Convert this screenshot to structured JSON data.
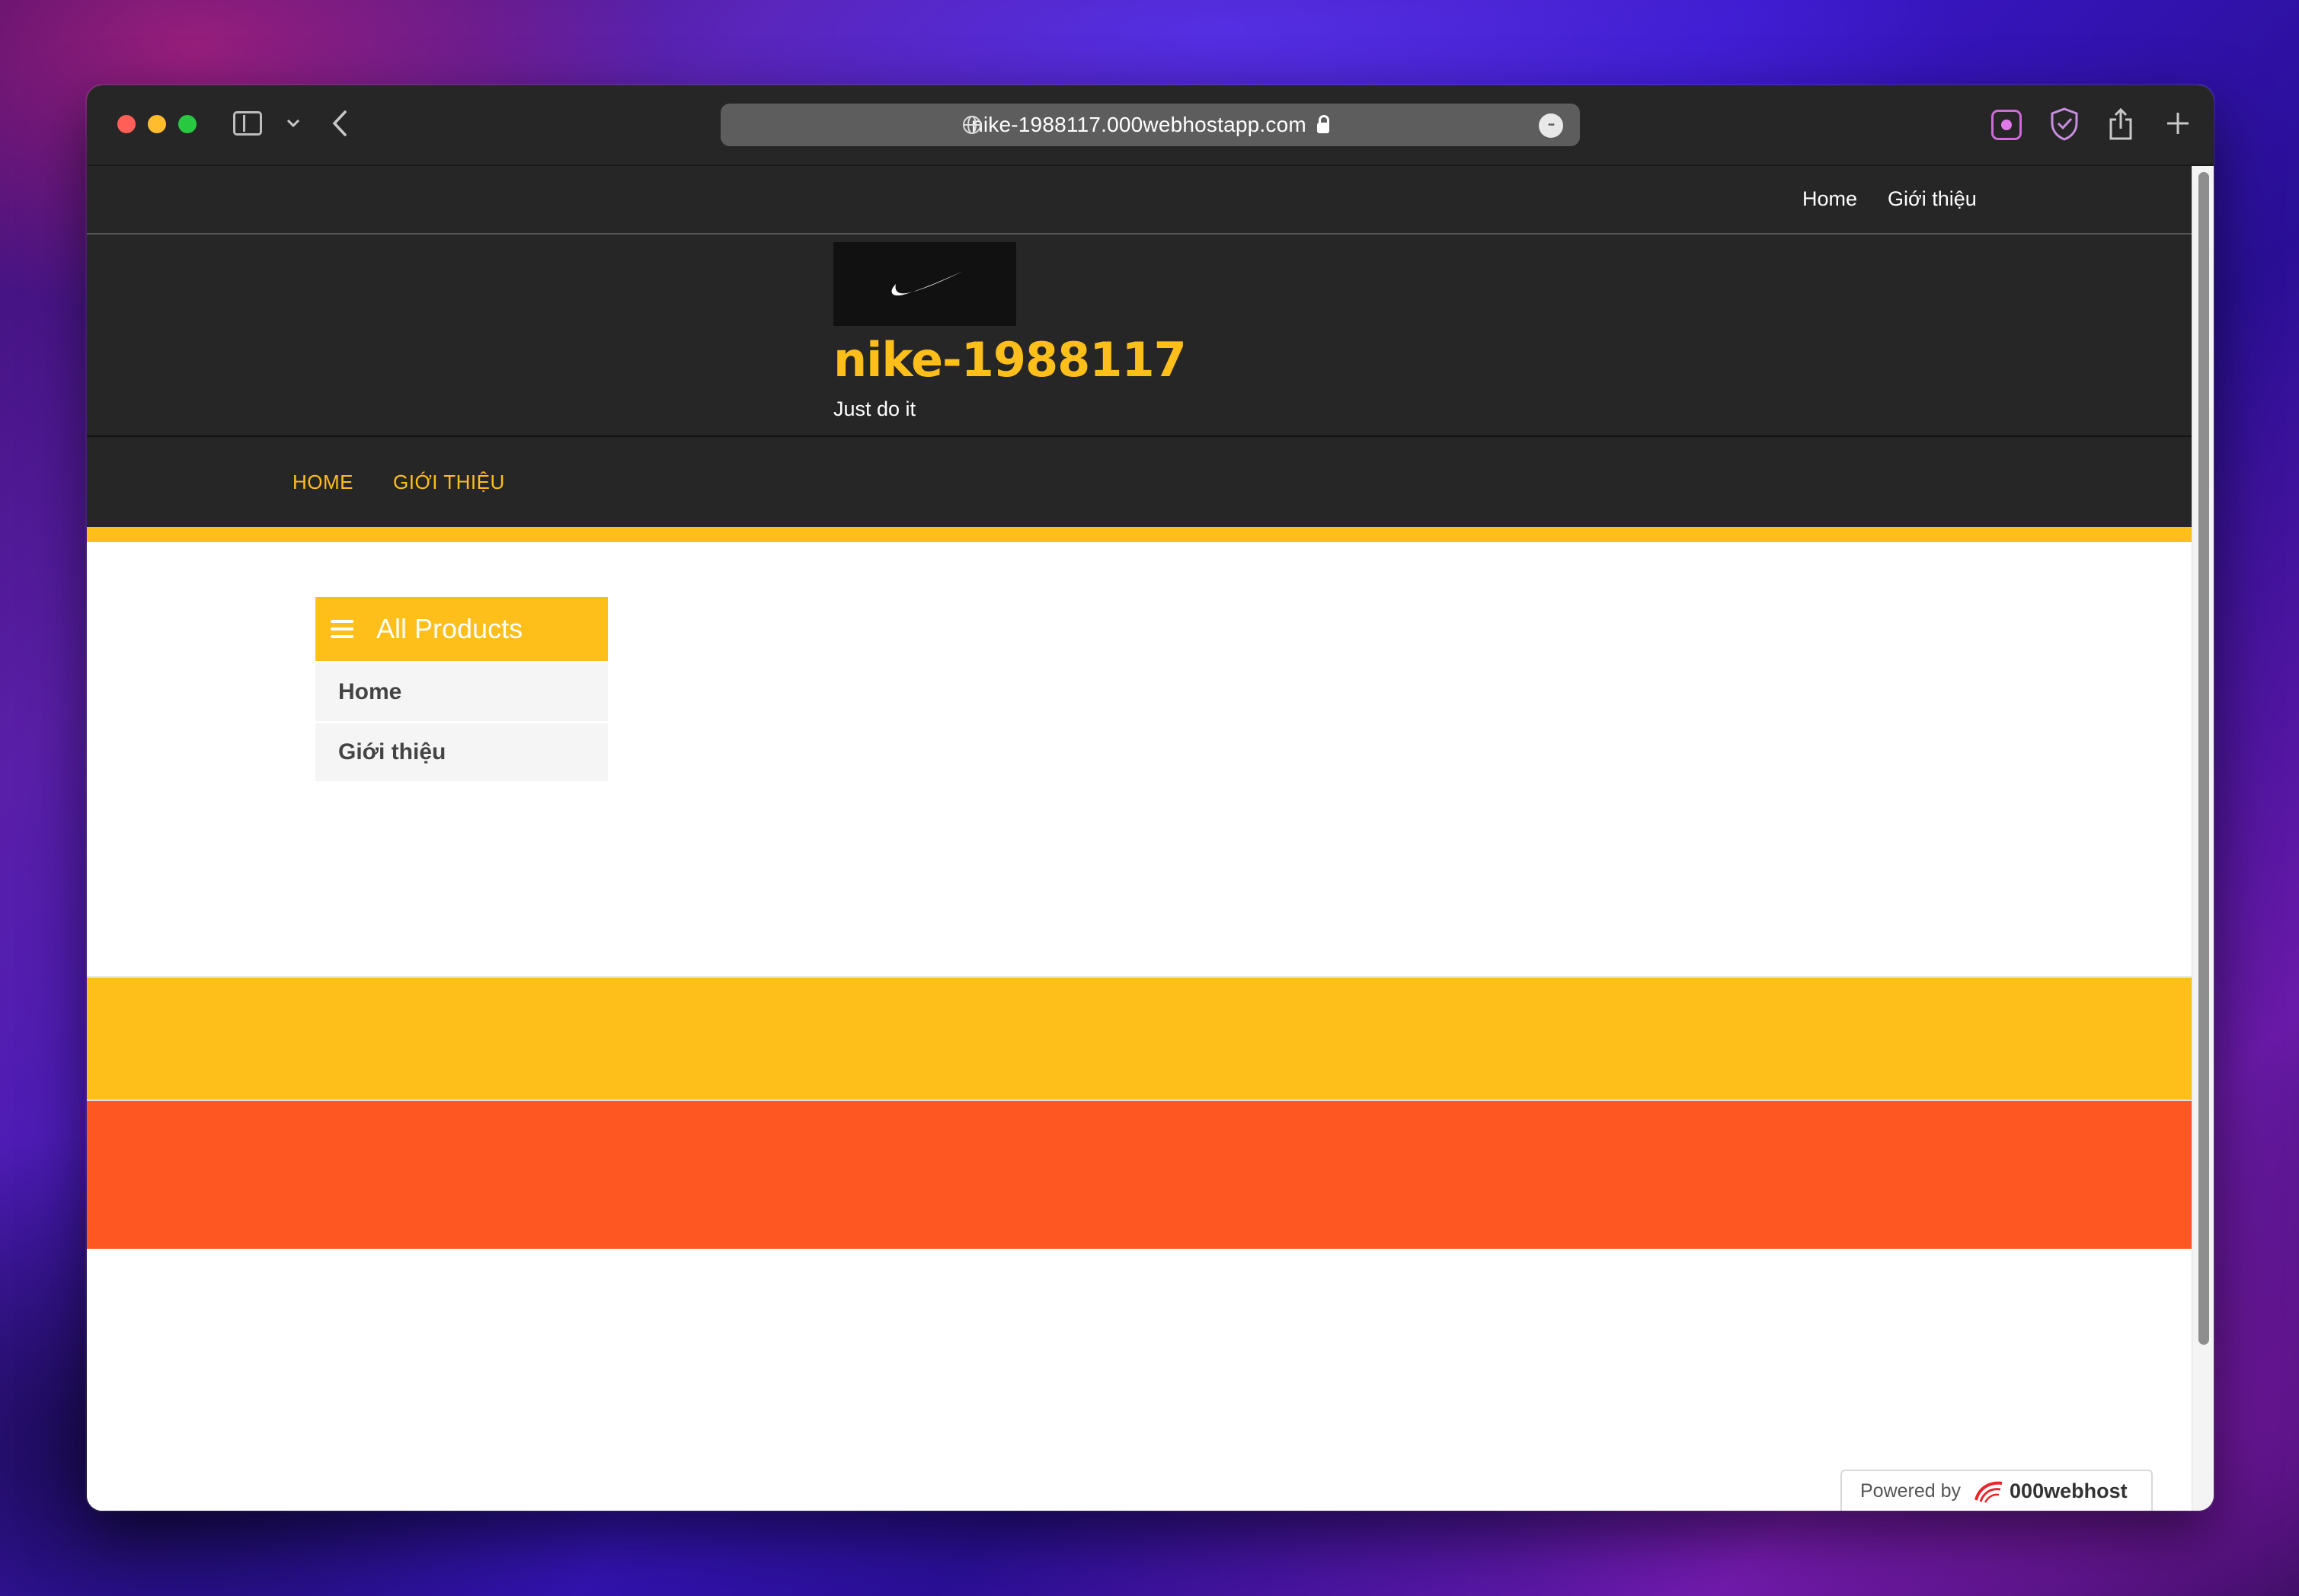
{
  "browser": {
    "url": "nike-1988117.000webhostapp.com",
    "more_symbol": "•••"
  },
  "top_nav": {
    "links": [
      {
        "label": "Home"
      },
      {
        "label": "Giới thiệu"
      }
    ]
  },
  "header": {
    "site_title": "nike-1988117",
    "tagline": "Just do it"
  },
  "main_nav": {
    "links": [
      {
        "label": "HOME"
      },
      {
        "label": "GIỚI THIỆU"
      }
    ]
  },
  "category_panel": {
    "title": "All Products",
    "items": [
      {
        "label": "Home"
      },
      {
        "label": "Giới thiệu"
      }
    ]
  },
  "badge": {
    "powered_by": "Powered by",
    "host_name": "000webhost"
  },
  "colors": {
    "accent_yellow": "#ffbf1a",
    "footer_orange": "#ff5722",
    "dark_bg": "#262626"
  }
}
